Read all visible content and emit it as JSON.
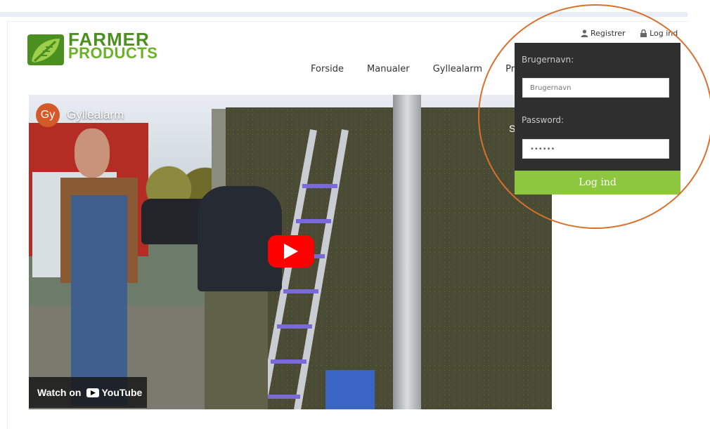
{
  "brand": {
    "line1": "FARMER",
    "line2": "PRODUCTS",
    "green": "#6bb12a"
  },
  "nav": {
    "items": [
      "Forside",
      "Manualer",
      "Gyllealarm",
      "Prod"
    ]
  },
  "user_links": {
    "register": "Registrer",
    "login": "Log ind"
  },
  "login_panel": {
    "username_label": "Brugernavn:",
    "username_placeholder": "Brugernavn",
    "password_label": "Password:",
    "password_value": "••••••",
    "submit_label": "Log ind",
    "button_color": "#8dc63f"
  },
  "video": {
    "channel_avatar": "Gy",
    "title": "Gyllealarm",
    "partial_text": "S",
    "watch_on": "Watch on",
    "youtube": "YouTube"
  },
  "annotation": {
    "color": "#d8702c"
  }
}
